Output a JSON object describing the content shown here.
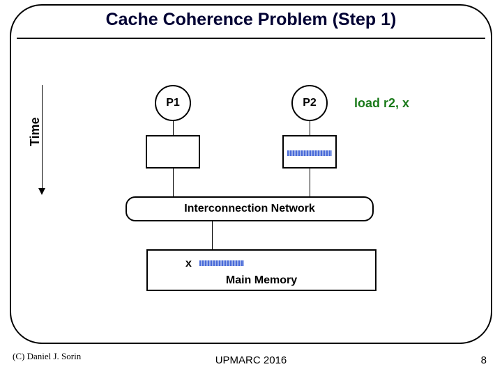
{
  "title": "Cache Coherence Problem (Step 1)",
  "time_axis_label": "Time",
  "processors": {
    "p1": "P1",
    "p2": "P2"
  },
  "annotation": {
    "load": "load r2, x"
  },
  "network_label": "Interconnection Network",
  "memory": {
    "var": "x",
    "label": "Main Memory"
  },
  "footer": {
    "copyright": "(C) Daniel J. Sorin",
    "conference": "UPMARC 2016",
    "page": "8"
  },
  "chart_data": {
    "type": "diagram",
    "title": "Cache Coherence Problem (Step 1)",
    "nodes": [
      {
        "id": "P1",
        "kind": "processor",
        "label": "P1"
      },
      {
        "id": "P2",
        "kind": "processor",
        "label": "P2"
      },
      {
        "id": "C1",
        "kind": "cache",
        "label": "",
        "contents": []
      },
      {
        "id": "C2",
        "kind": "cache",
        "label": "",
        "contents": [
          "x (loaded)"
        ]
      },
      {
        "id": "NET",
        "kind": "interconnect",
        "label": "Interconnection Network"
      },
      {
        "id": "MEM",
        "kind": "main-memory",
        "label": "Main Memory",
        "contents": [
          "x"
        ]
      }
    ],
    "edges": [
      {
        "from": "P1",
        "to": "C1"
      },
      {
        "from": "P2",
        "to": "C2"
      },
      {
        "from": "C1",
        "to": "NET"
      },
      {
        "from": "C2",
        "to": "NET"
      },
      {
        "from": "NET",
        "to": "MEM"
      }
    ],
    "annotations": [
      {
        "target": "P2",
        "text": "load r2, x",
        "color": "#1a7a1a"
      }
    ],
    "time_axis": {
      "orientation": "vertical",
      "direction": "down",
      "label": "Time"
    }
  }
}
